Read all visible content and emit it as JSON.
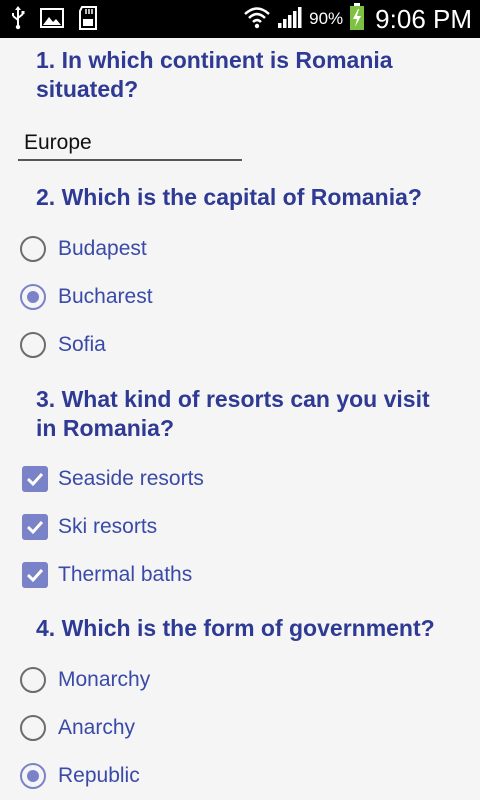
{
  "status_bar": {
    "battery_percent": "90%",
    "time": "9:06 PM",
    "icons": [
      "usb-icon",
      "image-icon",
      "sd-card-icon",
      "wifi-icon",
      "signal-icon",
      "battery-charging-icon"
    ]
  },
  "q1": {
    "question": "1. In which continent is Romania situated?",
    "answer": "Europe"
  },
  "q2": {
    "question": "2. Which is the capital of Romania?",
    "options": [
      {
        "label": "Budapest",
        "checked": false
      },
      {
        "label": "Bucharest",
        "checked": true
      },
      {
        "label": "Sofia",
        "checked": false
      }
    ]
  },
  "q3": {
    "question": "3. What kind of resorts can you visit in Romania?",
    "options": [
      {
        "label": "Seaside resorts",
        "checked": true
      },
      {
        "label": "Ski resorts",
        "checked": true
      },
      {
        "label": "Thermal baths",
        "checked": true
      }
    ]
  },
  "q4": {
    "question": "4. Which is the form of government?",
    "options": [
      {
        "label": "Monarchy",
        "checked": false
      },
      {
        "label": "Anarchy",
        "checked": false
      },
      {
        "label": "Republic",
        "checked": true
      }
    ]
  },
  "colors": {
    "question_text": "#2e3a93",
    "option_text": "#3a4aa8",
    "accent": "#7a83c8",
    "background": "#f5f5f5",
    "status_bar": "#000000"
  }
}
